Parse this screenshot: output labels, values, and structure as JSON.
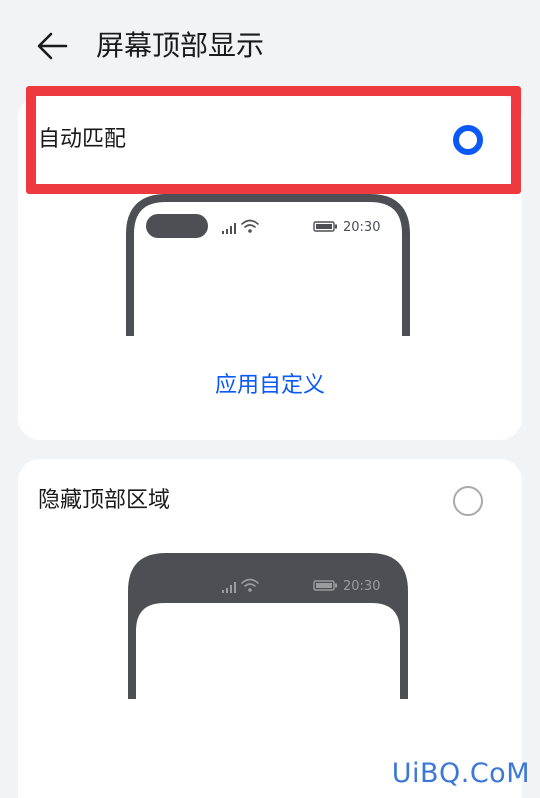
{
  "header": {
    "title": "屏幕顶部显示",
    "back_icon": "arrow-left-icon"
  },
  "options": [
    {
      "label": "自动匹配",
      "selected": true,
      "preview_time": "20:30",
      "link_label": "应用自定义"
    },
    {
      "label": "隐藏顶部区域",
      "selected": false,
      "preview_time": "20:30"
    }
  ],
  "watermark": "UiBQ.CoM",
  "colors": {
    "background": "#f1f3f5",
    "card": "#ffffff",
    "accent": "#0a59f7",
    "highlight": "#ee3a3f",
    "phone_frame": "#4d4f54"
  }
}
